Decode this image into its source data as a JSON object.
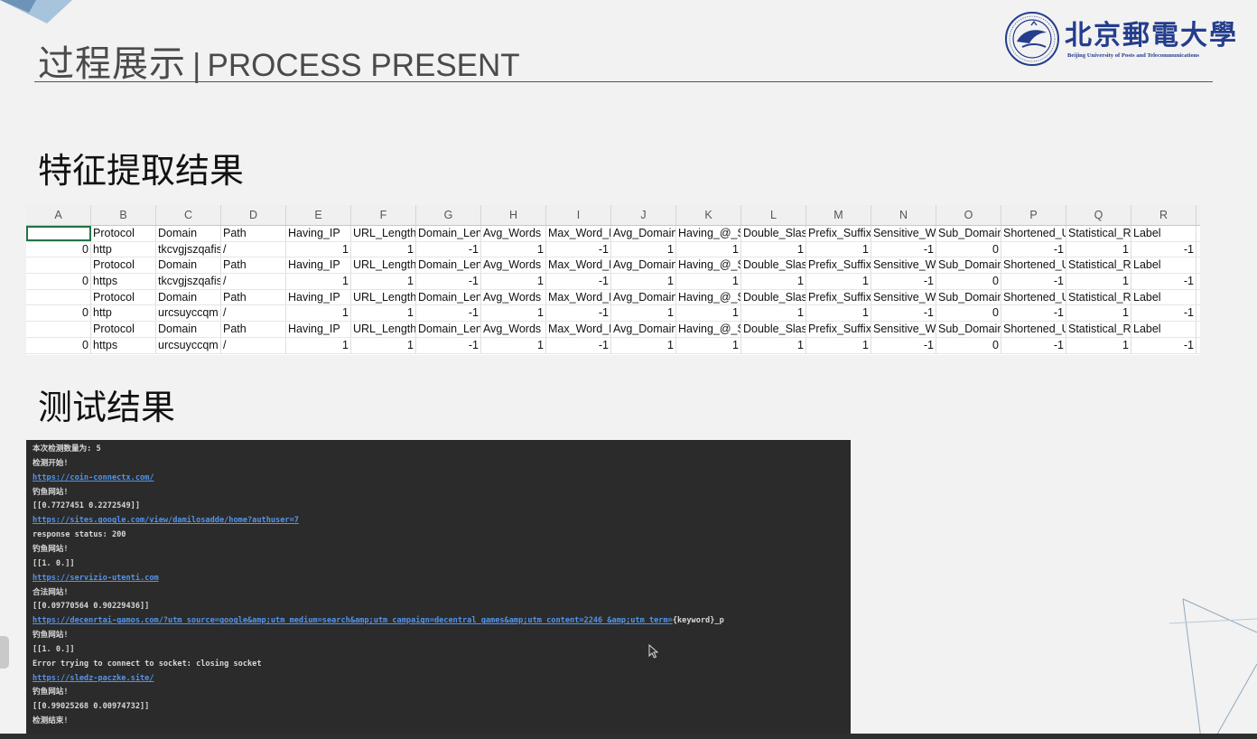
{
  "header": {
    "title_cn": "过程展示",
    "title_sep": "|",
    "title_en": "PROCESS PRESENT"
  },
  "logo": {
    "name_cn": "北京郵電大學",
    "name_en": "Beijing University of Posts and Telecommunications"
  },
  "sections": {
    "features_title": "特征提取结果",
    "test_title": "测试结果"
  },
  "spreadsheet": {
    "columns": [
      "A",
      "B",
      "C",
      "D",
      "E",
      "F",
      "G",
      "H",
      "I",
      "J",
      "K",
      "L",
      "M",
      "N",
      "O",
      "P",
      "Q",
      "R"
    ],
    "header_row": [
      "",
      "Protocol",
      "Domain",
      "Path",
      "Having_IP",
      "URL_Length",
      "Domain_Len",
      "Avg_Words",
      "Max_Word_L",
      "Avg_Domain",
      "Having_@_S",
      "Double_Slas",
      "Prefix_Suffix",
      "Sensitive_W",
      "Sub_Domain",
      "Shortened_U",
      "Statistical_R",
      "Label"
    ],
    "rows": [
      [
        "",
        "Protocol",
        "Domain",
        "Path",
        "Having_IP",
        "URL_Length",
        "Domain_Len",
        "Avg_Words",
        "Max_Word_L",
        "Avg_Domain",
        "Having_@_S",
        "Double_Slas",
        "Prefix_Suffix",
        "Sensitive_W",
        "Sub_Domain",
        "Shortened_U",
        "Statistical_R",
        "Label"
      ],
      [
        "0",
        "http",
        "tkcvgjszqafis",
        "/",
        "1",
        "1",
        "-1",
        "1",
        "-1",
        "1",
        "1",
        "1",
        "1",
        "-1",
        "0",
        "-1",
        "1",
        "-1"
      ],
      [
        "",
        "Protocol",
        "Domain",
        "Path",
        "Having_IP",
        "URL_Length",
        "Domain_Len",
        "Avg_Words",
        "Max_Word_L",
        "Avg_Domain",
        "Having_@_S",
        "Double_Slas",
        "Prefix_Suffix",
        "Sensitive_W",
        "Sub_Domain",
        "Shortened_U",
        "Statistical_R",
        "Label"
      ],
      [
        "0",
        "https",
        "tkcvgjszqafis",
        "/",
        "1",
        "1",
        "-1",
        "1",
        "-1",
        "1",
        "1",
        "1",
        "1",
        "-1",
        "0",
        "-1",
        "1",
        "-1"
      ],
      [
        "",
        "Protocol",
        "Domain",
        "Path",
        "Having_IP",
        "URL_Length",
        "Domain_Len",
        "Avg_Words",
        "Max_Word_L",
        "Avg_Domain",
        "Having_@_S",
        "Double_Slas",
        "Prefix_Suffix",
        "Sensitive_W",
        "Sub_Domain",
        "Shortened_U",
        "Statistical_R",
        "Label"
      ],
      [
        "0",
        "http",
        "urcsuyccqm",
        "/",
        "1",
        "1",
        "-1",
        "1",
        "-1",
        "1",
        "1",
        "1",
        "1",
        "-1",
        "0",
        "-1",
        "1",
        "-1"
      ],
      [
        "",
        "Protocol",
        "Domain",
        "Path",
        "Having_IP",
        "URL_Length",
        "Domain_Len",
        "Avg_Words",
        "Max_Word_L",
        "Avg_Domain",
        "Having_@_S",
        "Double_Slas",
        "Prefix_Suffix",
        "Sensitive_W",
        "Sub_Domain",
        "Shortened_U",
        "Statistical_R",
        "Label"
      ],
      [
        "0",
        "https",
        "urcsuyccqm",
        "/",
        "1",
        "1",
        "-1",
        "1",
        "-1",
        "1",
        "1",
        "1",
        "1",
        "-1",
        "0",
        "-1",
        "1",
        "-1"
      ]
    ]
  },
  "console": {
    "lines": [
      {
        "text": "本次检测数量为: 5",
        "link": false
      },
      {
        "text": "检测开始!",
        "link": false
      },
      {
        "text": "https://coin-connectx.com/",
        "link": true
      },
      {
        "text": "钓鱼网站!",
        "link": false
      },
      {
        "text": "[[0.7727451 0.2272549]]",
        "link": false
      },
      {
        "text": "https://sites.google.com/view/damilosadde/home?authuser=7",
        "link": true
      },
      {
        "text": "response status: 200",
        "link": false
      },
      {
        "text": "钓鱼网站!",
        "link": false
      },
      {
        "text": "[[1. 0.]]",
        "link": false
      },
      {
        "text": "https://servizio-utenti.com",
        "link": true
      },
      {
        "text": "合法网站!",
        "link": false
      },
      {
        "text": "[[0.09770564 0.90229436]]",
        "link": false
      },
      {
        "text": "https://decenrtai-gamos.com/?utm_source=google&amp;utm_medium=search&amp;utm_campaign=decentral_games&amp;utm_content=2246_&amp;utm_term=",
        "link": true,
        "suffix": "{keyword}_p"
      },
      {
        "text": "钓鱼网站!",
        "link": false
      },
      {
        "text": "[[1. 0.]]",
        "link": false
      },
      {
        "text": "Error trying to connect to socket: closing socket",
        "link": false
      },
      {
        "text": "https://sledz-paczke.site/",
        "link": true
      },
      {
        "text": "钓鱼网站!",
        "link": false
      },
      {
        "text": "[[0.99025268 0.00974732]]",
        "link": false
      },
      {
        "text": "检测结束!",
        "link": false
      }
    ]
  },
  "colors": {
    "logo_blue": "#243d8c",
    "console_bg": "#2b2b2b",
    "link_blue": "#5394ec",
    "selection_green": "#217346"
  },
  "icons": [
    "bupt-emblem-icon",
    "mouse-cursor-icon",
    "corner-triangle-decor",
    "line-decoration"
  ]
}
